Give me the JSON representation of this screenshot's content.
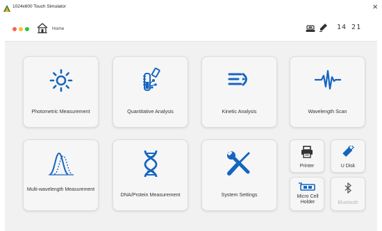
{
  "window": {
    "title": "1024x600 Touch Simulator",
    "close_label": "×"
  },
  "topbar": {
    "home_label": "Home",
    "time": "14 21",
    "icons": [
      "home-icon",
      "device-icon",
      "pen-icon"
    ]
  },
  "tiles": [
    {
      "label": "Photometric Measurement",
      "icon": "sun-icon"
    },
    {
      "label": "Quantitative Analysis",
      "icon": "flask-icon"
    },
    {
      "label": "Kinetic Analysis",
      "icon": "kinetic-icon"
    },
    {
      "label": "Wavelength Scan",
      "icon": "waveform-icon"
    },
    {
      "label": "Multi-wavelength Measurement",
      "icon": "peaks-icon"
    },
    {
      "label": "DNA/Protein Measurement",
      "icon": "dna-icon"
    },
    {
      "label": "System Settings",
      "icon": "tools-icon"
    }
  ],
  "small_tiles": [
    {
      "label": "Printer",
      "icon": "printer-icon",
      "enabled": true
    },
    {
      "label": "U Disk",
      "icon": "usb-icon",
      "enabled": true
    },
    {
      "label": "Micro Cell Holder",
      "icon": "cell-holder-icon",
      "enabled": true
    },
    {
      "label": "Bluetooth",
      "icon": "bluetooth-icon",
      "enabled": false
    }
  ],
  "colors": {
    "accent": "#1565c0",
    "background": "#f1f1f1",
    "tile": "#f6f6f6",
    "disabled_text": "#b8b8b8"
  }
}
